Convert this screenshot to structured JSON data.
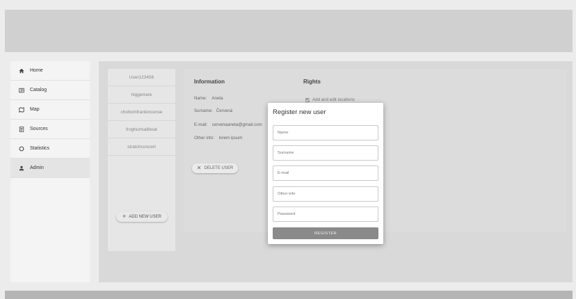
{
  "sidebar": {
    "items": [
      {
        "label": "Home",
        "icon": "home-icon"
      },
      {
        "label": "Catalog",
        "icon": "catalog-icon"
      },
      {
        "label": "Map",
        "icon": "map-icon"
      },
      {
        "label": "Sources",
        "icon": "sources-icon"
      },
      {
        "label": "Statistics",
        "icon": "statistics-icon"
      },
      {
        "label": "Admin",
        "icon": "admin-icon",
        "active": true
      }
    ]
  },
  "users": {
    "list": [
      "User123456",
      "higgerrare",
      "chottomfrankincense",
      "froghurtsailboat",
      "stratchconcert"
    ],
    "add_label": "ADD NEW USER"
  },
  "info": {
    "title": "Information",
    "name_label": "Name:",
    "name_value": "Aneta",
    "surname_label": "Surname:",
    "surname_value": "Červená",
    "email_label": "E-mail:",
    "email_value": "cervenaaneta@gmail.com",
    "other_label": "Other info:",
    "other_value": "lorem ipsum",
    "delete_label": "DELETE USER"
  },
  "rights": {
    "title": "Rights",
    "items": [
      "Add and edit locations"
    ]
  },
  "modal": {
    "title": "Register new user",
    "fields": {
      "name": "Name",
      "surname": "Surname",
      "email": "E-mail",
      "other": "Other info",
      "password": "Password"
    },
    "register_label": "REGISTER"
  },
  "colors": {
    "topbar": "#d0d0d0",
    "footer": "#b5b5b5",
    "register_button": "#8a8a8a"
  }
}
